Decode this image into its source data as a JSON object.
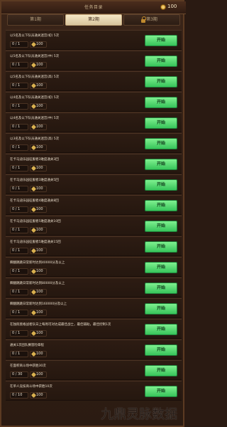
{
  "header": {
    "title": "任务目录",
    "coins": "100"
  },
  "tabs": [
    {
      "label": "第1期"
    },
    {
      "label": "第2期"
    },
    {
      "label": "第3期"
    }
  ],
  "tasks": [
    {
      "desc": "以5名及以下队员通关迷宫(初) 5次",
      "progress": "0 / 1",
      "reward": "100",
      "button": "开始"
    },
    {
      "desc": "以5名及以下队员通关迷宫(中) 5次",
      "progress": "0 / 1",
      "reward": "100",
      "button": "开始"
    },
    {
      "desc": "以5名及以下队员通关迷宫(高) 5次",
      "progress": "0 / 1",
      "reward": "100",
      "button": "开始"
    },
    {
      "desc": "以4名及以下队员通关迷宫(初) 5次",
      "progress": "0 / 1",
      "reward": "100",
      "button": "开始"
    },
    {
      "desc": "以4名及以下队员通关迷宫(中) 5次",
      "progress": "0 / 1",
      "reward": "100",
      "button": "开始"
    },
    {
      "desc": "以3名及以下队员通关迷宫(高) 5次",
      "progress": "0 / 1",
      "reward": "100",
      "button": "开始"
    },
    {
      "desc": "在卡马迪乐园征服者3难度通关3回",
      "progress": "0 / 1",
      "reward": "100",
      "button": "开始"
    },
    {
      "desc": "在卡马迪乐园征服者3难度通关5回",
      "progress": "0 / 1",
      "reward": "100",
      "button": "开始"
    },
    {
      "desc": "在卡马迪乐园征服者4难度通关8回",
      "progress": "0 / 1",
      "reward": "100",
      "button": "开始"
    },
    {
      "desc": "在卡马迪乐园征服者5难度通关10回",
      "progress": "0 / 1",
      "reward": "100",
      "button": "开始"
    },
    {
      "desc": "在卡马迪乐园征服者5难度通关15回",
      "progress": "0 / 1",
      "reward": "100",
      "button": "开始"
    },
    {
      "desc": "瞬翻跳跳日常新时达到40000分及以上",
      "progress": "0 / 1",
      "reward": "100",
      "button": "开始"
    },
    {
      "desc": "瞬翻跳跳日常新时达到80000分及以上",
      "progress": "0 / 1",
      "reward": "100",
      "button": "开始"
    },
    {
      "desc": "瞬翻跳跳日常新时达到160000分及以上",
      "progress": "0 / 1",
      "reward": "100",
      "button": "开始"
    },
    {
      "desc": "在独际莫格战者队日上每周可对达成最佳战士，最佳辅助，最佳控制1次",
      "progress": "0 / 1",
      "reward": "100",
      "button": "开始"
    },
    {
      "desc": "通关1次团队赛冒险章程",
      "progress": "0 / 1",
      "reward": "100",
      "button": "开始"
    },
    {
      "desc": "在面积商斗场中获胜30次",
      "progress": "0 / 30",
      "reward": "100",
      "button": "开始"
    },
    {
      "desc": "在单人竞技商斗场中获胜10次",
      "progress": "0 / 10",
      "reward": "100",
      "button": "开始"
    }
  ],
  "watermark": "九鼎灵脉数据"
}
